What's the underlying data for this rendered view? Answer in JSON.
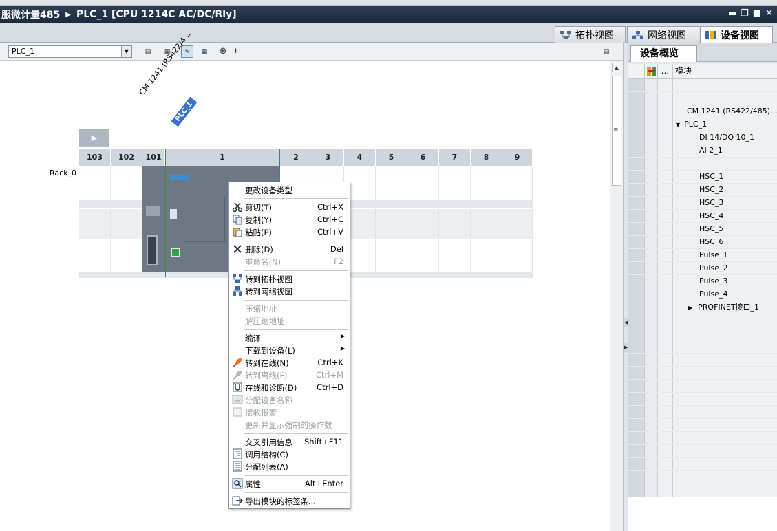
{
  "title": {
    "project": "服微计量485",
    "device": "PLC_1 [CPU 1214C AC/DC/Rly]"
  },
  "view_tabs": [
    "拓扑视图",
    "网络视图",
    "设备视图"
  ],
  "toolbar": {
    "device_select": "PLC_1"
  },
  "canvas": {
    "rack_label": "Rack_0",
    "module_label": "CM 1241 (RS422/4...",
    "plc_tag": "PLC_1",
    "slots": [
      "103",
      "102",
      "101",
      "1",
      "2",
      "3",
      "4",
      "5",
      "6",
      "7",
      "8",
      "9"
    ]
  },
  "context_menu": {
    "items": [
      {
        "label": "更改设备类型",
        "shortcut": "",
        "disabled": false
      },
      {
        "label": "剪切(T)",
        "shortcut": "Ctrl+X",
        "disabled": false,
        "icon": "scissors-icon"
      },
      {
        "label": "复制(Y)",
        "shortcut": "Ctrl+C",
        "disabled": false,
        "icon": "copy-icon"
      },
      {
        "label": "粘贴(P)",
        "shortcut": "Ctrl+V",
        "disabled": false,
        "icon": "paste-icon"
      },
      {
        "label": "删除(D)",
        "shortcut": "Del",
        "disabled": false,
        "icon": "delete-icon"
      },
      {
        "label": "重命名(N)",
        "shortcut": "F2",
        "disabled": true
      },
      {
        "label": "转到拓扑视图",
        "shortcut": "",
        "disabled": false,
        "icon": "topology-icon"
      },
      {
        "label": "转到网络视图",
        "shortcut": "",
        "disabled": false,
        "icon": "network-icon"
      },
      {
        "label": "压缩地址",
        "shortcut": "",
        "disabled": true
      },
      {
        "label": "解压缩地址",
        "shortcut": "",
        "disabled": true
      },
      {
        "label": "编译",
        "shortcut": "",
        "disabled": false,
        "submenu": true
      },
      {
        "label": "下载到设备(L)",
        "shortcut": "",
        "disabled": false,
        "submenu": true
      },
      {
        "label": "转到在线(N)",
        "shortcut": "Ctrl+K",
        "disabled": false,
        "icon": "go-online-icon"
      },
      {
        "label": "转到离线(F)",
        "shortcut": "Ctrl+M",
        "disabled": true,
        "icon": "go-offline-icon"
      },
      {
        "label": "在线和诊断(D)",
        "shortcut": "Ctrl+D",
        "disabled": false,
        "icon": "diagnostics-icon"
      },
      {
        "label": "分配设备名称",
        "shortcut": "",
        "disabled": true,
        "icon": "assign-name-icon"
      },
      {
        "label": "接收报警",
        "shortcut": "",
        "disabled": true,
        "icon": "alarm-icon"
      },
      {
        "label": "更新并显示强制的操作数",
        "shortcut": "",
        "disabled": true
      },
      {
        "label": "交叉引用信息",
        "shortcut": "Shift+F11",
        "disabled": false
      },
      {
        "label": "调用结构(C)",
        "shortcut": "",
        "disabled": false,
        "icon": "call-structure-icon"
      },
      {
        "label": "分配列表(A)",
        "shortcut": "",
        "disabled": false,
        "icon": "assignment-list-icon"
      },
      {
        "label": "属性",
        "shortcut": "Alt+Enter",
        "disabled": false,
        "icon": "properties-icon"
      },
      {
        "label": "导出模块的标签条...",
        "shortcut": "",
        "disabled": false,
        "icon": "export-icon"
      }
    ]
  },
  "overview": {
    "tab": "设备概览",
    "col_more": "...",
    "col_module": "模块",
    "rows": [
      "",
      "",
      "CM 1241 (RS422/485)...",
      "PLC_1",
      "DI 14/DQ 10_1",
      "AI 2_1",
      "",
      "HSC_1",
      "HSC_2",
      "HSC_3",
      "HSC_4",
      "HSC_5",
      "HSC_6",
      "Pulse_1",
      "Pulse_2",
      "Pulse_3",
      "Pulse_4",
      "PROFINET接口_1"
    ]
  },
  "colors": {
    "titlebar": "#1b2a3d",
    "accent": "#3a72c8",
    "module": "#6d7884"
  }
}
